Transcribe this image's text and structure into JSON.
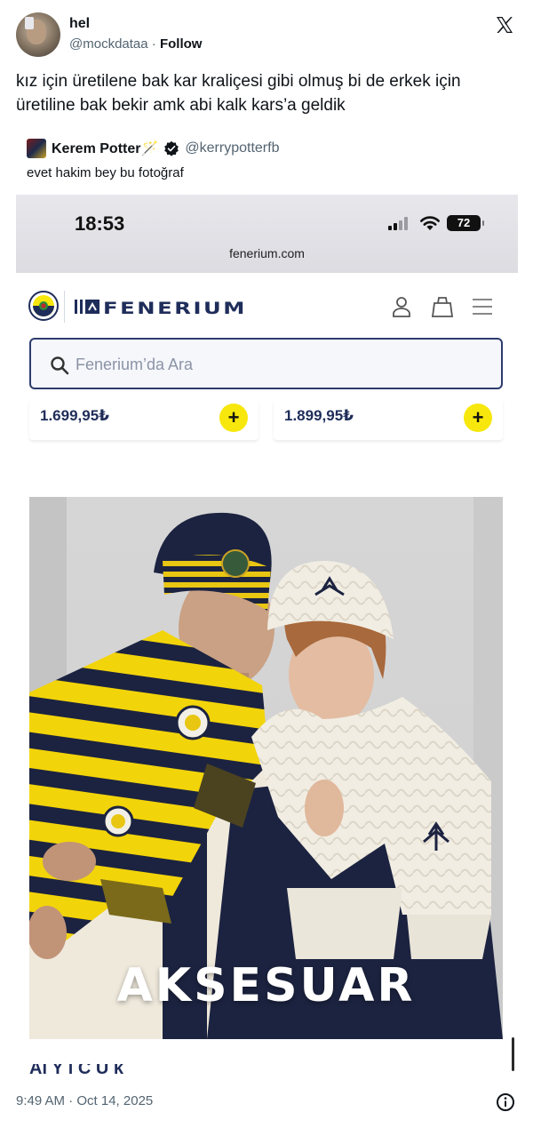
{
  "tweet": {
    "display_name": "hel",
    "handle": "@mockdataa",
    "separator": " · ",
    "follow_label": "Follow",
    "text": "kız için üretilene bak kar kraliçesi gibi olmuş bi de erkek için üretiline bak bekir amk abi kalk kars’a geldik",
    "timestamp": "9:49 AM · Oct 14, 2025"
  },
  "quoted": {
    "name": "Kerem Potter🪄",
    "handle": "@kerrypotterfb",
    "text": "evet hakim bey bu fotoğraf"
  },
  "screenshot": {
    "clock": "18:53",
    "battery": "72",
    "url": "fenerium.com",
    "site_name": "FENERIUM",
    "search_placeholder": "Fenerium’da Ara",
    "prices": [
      "1.699,95₺",
      "1.899,95₺"
    ],
    "add_symbol": "+",
    "banner_text": "AKSESUAR",
    "partial_text": "Al    Y   i C    Ü    k"
  },
  "icons": [
    "x-logo-icon",
    "verified-badge-icon",
    "search-icon",
    "user-icon",
    "bag-icon",
    "menu-icon",
    "info-icon",
    "wifi-icon",
    "signal-icon"
  ],
  "colors": {
    "accent_yellow": "#f7e70c",
    "navy": "#1f2d5a",
    "muted_text": "#536471"
  }
}
